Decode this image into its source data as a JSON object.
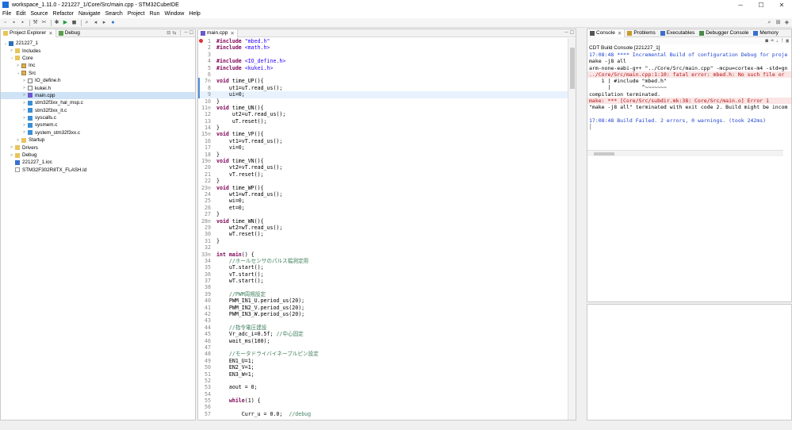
{
  "window": {
    "title": "workspace_1.11.0 - 221227_1/Core/Src/main.cpp - STM32CubeIDE",
    "min": "─",
    "max": "☐",
    "close": "✕"
  },
  "menu": [
    "File",
    "Edit",
    "Source",
    "Refactor",
    "Navigate",
    "Search",
    "Project",
    "Run",
    "Window",
    "Help"
  ],
  "explorer": {
    "tabs": [
      {
        "label": "Project Explorer"
      },
      {
        "label": "Debug"
      }
    ],
    "tree": [
      {
        "label": "221227_1",
        "depth": 0,
        "arrow": "⌄",
        "icon": "proj"
      },
      {
        "label": "Includes",
        "depth": 1,
        "arrow": ">",
        "icon": "folder"
      },
      {
        "label": "Core",
        "depth": 1,
        "arrow": "⌄",
        "icon": "folder"
      },
      {
        "label": "Inc",
        "depth": 2,
        "arrow": ">",
        "icon": "src"
      },
      {
        "label": "Src",
        "depth": 2,
        "arrow": "⌄",
        "icon": "src"
      },
      {
        "label": "IO_define.h",
        "depth": 3,
        "arrow": ">",
        "icon": "h"
      },
      {
        "label": "kukei.h",
        "depth": 3,
        "arrow": ">",
        "icon": "h"
      },
      {
        "label": "main.cpp",
        "depth": 3,
        "arrow": ">",
        "icon": "cpp",
        "selected": true
      },
      {
        "label": "stm32f3xx_hal_msp.c",
        "depth": 3,
        "arrow": ">",
        "icon": "c"
      },
      {
        "label": "stm32f3xx_it.c",
        "depth": 3,
        "arrow": ">",
        "icon": "c"
      },
      {
        "label": "syscalls.c",
        "depth": 3,
        "arrow": ">",
        "icon": "c"
      },
      {
        "label": "sysmem.c",
        "depth": 3,
        "arrow": ">",
        "icon": "c"
      },
      {
        "label": "system_stm32f3xx.c",
        "depth": 3,
        "arrow": ">",
        "icon": "c"
      },
      {
        "label": "Startup",
        "depth": 2,
        "arrow": ">",
        "icon": "folder"
      },
      {
        "label": "Drivers",
        "depth": 1,
        "arrow": ">",
        "icon": "folder"
      },
      {
        "label": "Debug",
        "depth": 1,
        "arrow": ">",
        "icon": "folder"
      },
      {
        "label": "221227_1.ioc",
        "depth": 1,
        "arrow": "",
        "icon": "ioc"
      },
      {
        "label": "STM32F302R8TX_FLASH.ld",
        "depth": 1,
        "arrow": "",
        "icon": "file"
      }
    ]
  },
  "editor": {
    "tab": "main.cpp",
    "lines": [
      {
        "n": "1",
        "t": [
          [
            "kw",
            "#include "
          ],
          [
            "str",
            "\"mbed.h\""
          ]
        ],
        "err": true
      },
      {
        "n": "2",
        "t": [
          [
            "kw",
            "#include "
          ],
          [
            "str",
            "<math.h>"
          ]
        ]
      },
      {
        "n": "3",
        "t": []
      },
      {
        "n": "4",
        "t": [
          [
            "kw",
            "#include "
          ],
          [
            "str",
            "<IO_define.h>"
          ]
        ]
      },
      {
        "n": "5",
        "t": [
          [
            "kw",
            "#include "
          ],
          [
            "str",
            "<kukei.h>"
          ]
        ]
      },
      {
        "n": "6",
        "t": []
      },
      {
        "n": "7⊖",
        "t": [
          [
            "kw",
            "void "
          ],
          [
            "",
            "time_UP(){"
          ]
        ]
      },
      {
        "n": "8",
        "t": [
          [
            "",
            "    ut1=uT.read_us();"
          ]
        ]
      },
      {
        "n": "9",
        "t": [
          [
            "",
            "    ui=0;"
          ]
        ],
        "hl": true
      },
      {
        "n": "10",
        "t": [
          [
            "",
            "}"
          ]
        ]
      },
      {
        "n": "11⊖",
        "t": [
          [
            "kw",
            "void "
          ],
          [
            "",
            "time_UN(){"
          ]
        ]
      },
      {
        "n": "12",
        "t": [
          [
            "",
            "     ut2=uT.read_us();"
          ]
        ]
      },
      {
        "n": "13",
        "t": [
          [
            "",
            "     uT.reset();"
          ]
        ]
      },
      {
        "n": "14",
        "t": [
          [
            "",
            "}"
          ]
        ]
      },
      {
        "n": "15⊖",
        "t": [
          [
            "kw",
            "void "
          ],
          [
            "",
            "time_VP(){"
          ]
        ]
      },
      {
        "n": "16",
        "t": [
          [
            "",
            "    vt1=vT.read_us();"
          ]
        ]
      },
      {
        "n": "17",
        "t": [
          [
            "",
            "    vi=0;"
          ]
        ]
      },
      {
        "n": "18",
        "t": [
          [
            "",
            "}"
          ]
        ]
      },
      {
        "n": "19⊖",
        "t": [
          [
            "kw",
            "void "
          ],
          [
            "",
            "time_VN(){"
          ]
        ]
      },
      {
        "n": "20",
        "t": [
          [
            "",
            "    vt2=vT.read_us();"
          ]
        ]
      },
      {
        "n": "21",
        "t": [
          [
            "",
            "    vT.reset();"
          ]
        ]
      },
      {
        "n": "22",
        "t": [
          [
            "",
            "}"
          ]
        ]
      },
      {
        "n": "23⊖",
        "t": [
          [
            "kw",
            "void "
          ],
          [
            "",
            "time_WP(){"
          ]
        ]
      },
      {
        "n": "24",
        "t": [
          [
            "",
            "    wt1=wT.read_us();"
          ]
        ]
      },
      {
        "n": "25",
        "t": [
          [
            "",
            "    wi=0;"
          ]
        ]
      },
      {
        "n": "26",
        "t": [
          [
            "",
            "    et=0;"
          ]
        ]
      },
      {
        "n": "27",
        "t": [
          [
            "",
            "}"
          ]
        ]
      },
      {
        "n": "28⊖",
        "t": [
          [
            "kw",
            "void "
          ],
          [
            "",
            "time_WN(){"
          ]
        ]
      },
      {
        "n": "29",
        "t": [
          [
            "",
            "    wt2=wT.read_us();"
          ]
        ]
      },
      {
        "n": "30",
        "t": [
          [
            "",
            "    wT.reset();"
          ]
        ]
      },
      {
        "n": "31",
        "t": [
          [
            "",
            "}"
          ]
        ]
      },
      {
        "n": "32",
        "t": []
      },
      {
        "n": "33⊖",
        "t": [
          [
            "kw",
            "int "
          ],
          [
            "kw",
            "main"
          ],
          [
            "",
            "() {"
          ]
        ]
      },
      {
        "n": "34",
        "t": [
          [
            "cm",
            "    //ホールセンサのパルス幅測定用"
          ]
        ]
      },
      {
        "n": "35",
        "t": [
          [
            "",
            "    uT.start();"
          ]
        ]
      },
      {
        "n": "36",
        "t": [
          [
            "",
            "    vT.start();"
          ]
        ]
      },
      {
        "n": "37",
        "t": [
          [
            "",
            "    wT.start();"
          ]
        ]
      },
      {
        "n": "38",
        "t": []
      },
      {
        "n": "39",
        "t": [
          [
            "cm",
            "    //PWM周期設定"
          ]
        ]
      },
      {
        "n": "40",
        "t": [
          [
            "",
            "    PWM_IN1_U.period_us(20);"
          ]
        ]
      },
      {
        "n": "41",
        "t": [
          [
            "",
            "    PWM_IN2_V.period_us(20);"
          ]
        ]
      },
      {
        "n": "42",
        "t": [
          [
            "",
            "    PWM_IN3_W.period_us(20);"
          ]
        ]
      },
      {
        "n": "43",
        "t": []
      },
      {
        "n": "44",
        "t": [
          [
            "cm",
            "    //指令電圧建設"
          ]
        ]
      },
      {
        "n": "45",
        "t": [
          [
            "",
            "    Vr_adc_i=0.5f; "
          ],
          [
            "cm",
            "//中心固定"
          ]
        ]
      },
      {
        "n": "46",
        "t": [
          [
            "",
            "    wait_ms(100);"
          ]
        ]
      },
      {
        "n": "47",
        "t": []
      },
      {
        "n": "48",
        "t": [
          [
            "cm",
            "    //モータドライバイネーブルピン設定"
          ]
        ]
      },
      {
        "n": "49",
        "t": [
          [
            "",
            "    EN1_U=1;"
          ]
        ]
      },
      {
        "n": "50",
        "t": [
          [
            "",
            "    EN2_V=1;"
          ]
        ]
      },
      {
        "n": "51",
        "t": [
          [
            "",
            "    EN3_W=1;"
          ]
        ]
      },
      {
        "n": "52",
        "t": []
      },
      {
        "n": "53",
        "t": [
          [
            "",
            "    aout = 0;"
          ]
        ]
      },
      {
        "n": "54",
        "t": []
      },
      {
        "n": "55",
        "t": [
          [
            "",
            "    "
          ],
          [
            "kw",
            "while"
          ],
          [
            "",
            "(1) {"
          ]
        ]
      },
      {
        "n": "56",
        "t": []
      },
      {
        "n": "57",
        "t": [
          [
            "",
            "        Curr_u = 0.0;  "
          ],
          [
            "cm",
            "//debug"
          ]
        ]
      }
    ]
  },
  "console": {
    "tabs": [
      {
        "label": "Console"
      },
      {
        "label": "Problems"
      },
      {
        "label": "Executables"
      },
      {
        "label": "Debugger Console"
      },
      {
        "label": "Memory"
      }
    ],
    "header": "CDT Build Console [221227_1]",
    "lines": [
      {
        "t": "17:08:48 **** Incremental Build of configuration Debug for proje",
        "c": "blue"
      },
      {
        "t": "make -j8 all",
        "c": ""
      },
      {
        "t": "arm-none-eabi-g++ \"../Core/Src/main.cpp\" -mcpu=cortex-m4 -std=gn",
        "c": ""
      },
      {
        "t": "../Core/Src/main.cpp:1:10: fatal error: mbed.h: No such file or",
        "c": "red errbg"
      },
      {
        "t": "    1 | #include \"mbed.h\"",
        "c": ""
      },
      {
        "t": "      |          ^~~~~~~~",
        "c": ""
      },
      {
        "t": "compilation terminated.",
        "c": ""
      },
      {
        "t": "make: *** [Core/Src/subdir.mk:38: Core/Src/main.o] Error 1",
        "c": "red errbg"
      },
      {
        "t": "\"make -j8 all\" terminated with exit code 2. Build might be incom",
        "c": ""
      },
      {
        "t": "",
        "c": ""
      },
      {
        "t": "17:08:48 Build Failed. 2 errors, 0 warnings. (took 242ms)",
        "c": "blue"
      }
    ]
  }
}
